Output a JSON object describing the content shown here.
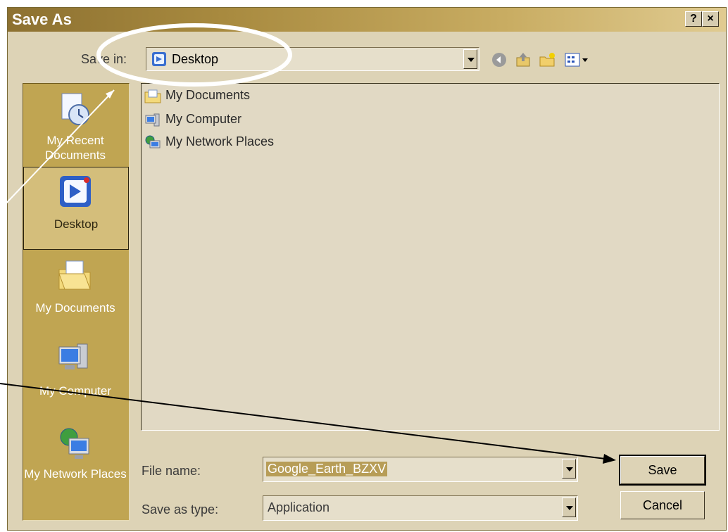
{
  "dialog": {
    "title": "Save As",
    "help_label": "?",
    "close_label": "×"
  },
  "save_in": {
    "label": "Save in:",
    "value": "Desktop"
  },
  "toolbar": {
    "icons": [
      "back-icon",
      "up-folder-icon",
      "new-folder-icon",
      "view-menu-icon"
    ]
  },
  "places": [
    {
      "label": "My Recent Documents",
      "icon": "recent-documents-icon"
    },
    {
      "label": "Desktop",
      "icon": "desktop-icon"
    },
    {
      "label": "My Documents",
      "icon": "my-documents-icon"
    },
    {
      "label": "My Computer",
      "icon": "my-computer-icon"
    },
    {
      "label": "My Network Places",
      "icon": "network-places-icon"
    }
  ],
  "files": [
    {
      "label": "My Documents",
      "icon": "folder-icon"
    },
    {
      "label": "My Computer",
      "icon": "computer-icon"
    },
    {
      "label": "My Network Places",
      "icon": "network-icon"
    }
  ],
  "file_name": {
    "label": "File name:",
    "value": "Google_Earth_BZXV"
  },
  "save_as_type": {
    "label": "Save as type:",
    "value": "Application"
  },
  "buttons": {
    "save": "Save",
    "cancel": "Cancel"
  },
  "colors": {
    "title_bar": "#8d7131",
    "places_bar": "#c0a552",
    "dialog_bg": "#ddd3b6",
    "highlight": "#b79d57"
  }
}
